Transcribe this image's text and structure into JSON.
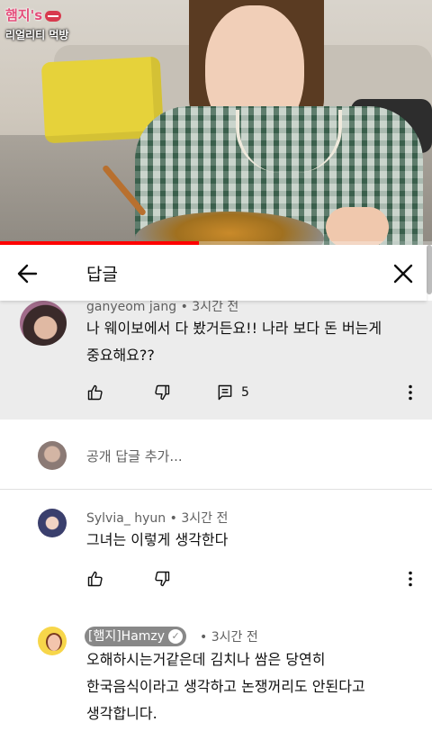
{
  "video": {
    "logo_line1": "햄지's",
    "logo_line2": "리얼리티 먹방",
    "progress": 0.46
  },
  "header": {
    "title": "답글"
  },
  "parent_comment": {
    "author": "ganyeom jang",
    "time": "3시간 전",
    "text_line1": "나 웨이보에서 다 봤거든요!! 나라 보다 돈 버는게",
    "text_line2": "중요해요??",
    "reply_count": "5"
  },
  "reply_box": {
    "placeholder": "공개 답글 추가..."
  },
  "replies": [
    {
      "author": "Sylvia_ hyun",
      "time": "3시간 전",
      "text": "그녀는 이렇게 생각한다"
    },
    {
      "author": "[햄지]Hamzy",
      "time": "3시간 전",
      "text_line1": "오해하시는거같은데 김치나 쌈은 당연히",
      "text_line2": "한국음식이라고 생각하고 논쟁꺼리도 안된다고",
      "text_line3": "생각합니다."
    }
  ],
  "separator": "•",
  "icons": [
    "back-arrow-icon",
    "close-icon",
    "thumbs-up-icon",
    "thumbs-down-icon",
    "reply-icon",
    "more-vert-icon",
    "verified-check-icon"
  ],
  "colors": {
    "progress": "#ff0000",
    "parent_bg": "#ececec",
    "meta_text": "#606060",
    "author_chip": "#888888"
  }
}
